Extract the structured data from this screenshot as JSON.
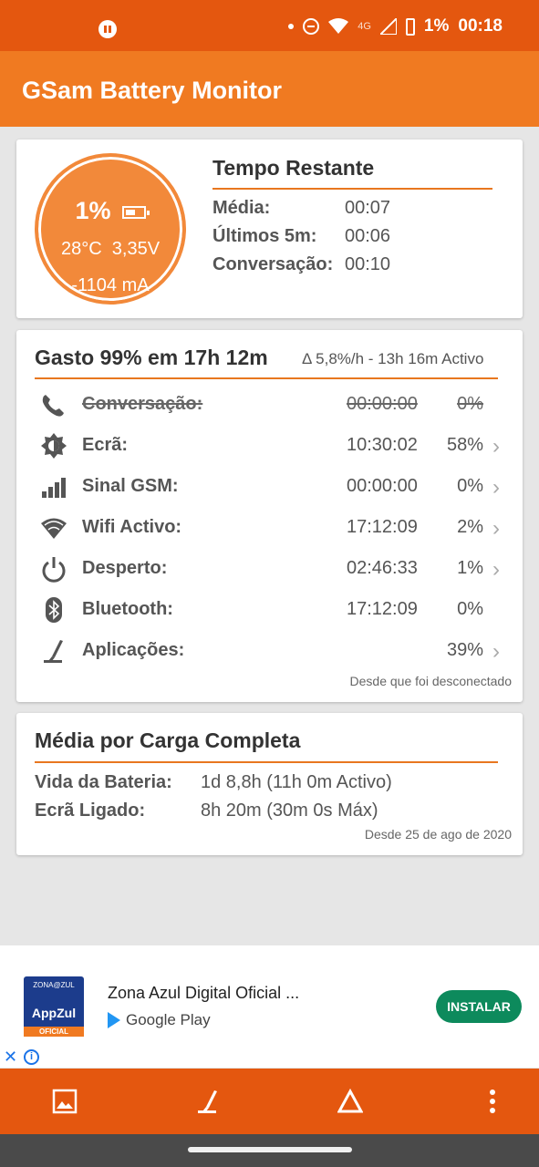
{
  "status_bar": {
    "network": "4G",
    "battery": "1%",
    "time": "00:18"
  },
  "app": {
    "title": "GSam Battery Monitor"
  },
  "gauge": {
    "percent": "1%",
    "temperature": "28°C",
    "voltage": "3,35V",
    "current": "-1104 mA"
  },
  "remaining": {
    "title": "Tempo Restante",
    "rows": [
      {
        "label": "Média:",
        "value": "00:07"
      },
      {
        "label": "Últimos 5m:",
        "value": "00:06"
      },
      {
        "label": "Conversação:",
        "value": "00:10"
      }
    ]
  },
  "usage": {
    "title": "Gasto 99% em 17h 12m",
    "rate": "Δ 5,8%/h - 13h 16m Activo",
    "rows": [
      {
        "icon": "phone-icon",
        "label": "Conversação:",
        "time": "00:00:00",
        "percent": "0%",
        "chevron": false,
        "strike": true
      },
      {
        "icon": "brightness-icon",
        "label": "Ecrã:",
        "time": "10:30:02",
        "percent": "58%",
        "chevron": true
      },
      {
        "icon": "signal-icon",
        "label": "Sinal GSM:",
        "time": "00:00:00",
        "percent": "0%",
        "chevron": true
      },
      {
        "icon": "wifi-icon",
        "label": "Wifi Activo:",
        "time": "17:12:09",
        "percent": "2%",
        "chevron": true
      },
      {
        "icon": "power-icon",
        "label": "Desperto:",
        "time": "02:46:33",
        "percent": "1%",
        "chevron": true
      },
      {
        "icon": "bluetooth-icon",
        "label": "Bluetooth:",
        "time": "17:12:09",
        "percent": "0%",
        "chevron": false
      },
      {
        "icon": "apps-icon",
        "label": "Aplicações:",
        "time": "",
        "percent": "39%",
        "chevron": true
      }
    ],
    "footnote": "Desde que foi desconectado",
    "chevron_glyph": "›"
  },
  "average": {
    "title": "Média por Carga Completa",
    "rows": [
      {
        "label": "Vida da Bateria:",
        "value": "1d 8,8h (11h 0m Activo)"
      },
      {
        "label": "Ecrã Ligado:",
        "value": "8h 20m (30m 0s Máx)"
      }
    ],
    "footnote": "Desde 25 de ago de 2020"
  },
  "ad": {
    "logo_top": "ZONA@ZUL",
    "logo_name": "AppZul",
    "logo_badge": "OFICIAL",
    "name": "Zona Azul Digital Oficial ...",
    "store": "Google Play",
    "install": "INSTALAR",
    "close": "✕",
    "info": "i"
  },
  "colors": {
    "primary": "#f07a21",
    "dark": "#e4570f",
    "install": "#0d8a5c"
  }
}
